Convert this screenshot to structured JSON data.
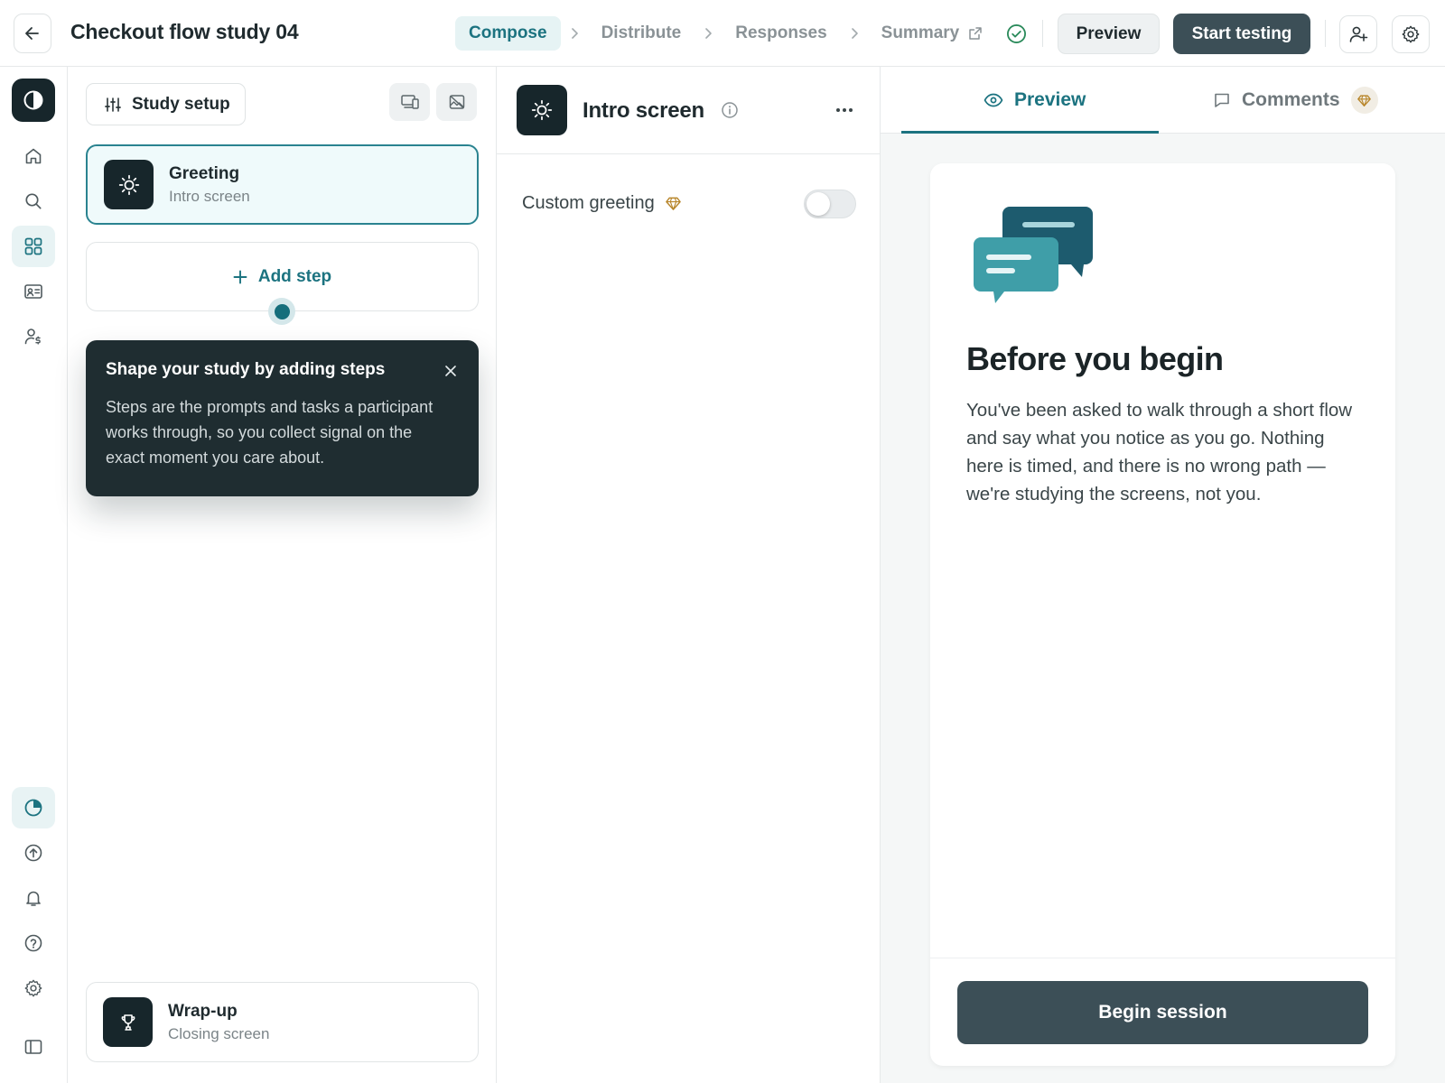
{
  "header": {
    "title": "Checkout flow study 04",
    "steps": [
      {
        "label": "Compose"
      },
      {
        "label": "Distribute"
      },
      {
        "label": "Responses"
      },
      {
        "label": "Summary"
      }
    ],
    "preview_label": "Preview",
    "start_label": "Start testing"
  },
  "steps_panel": {
    "setup_label": "Study setup",
    "steps": [
      {
        "name": "Greeting",
        "sub": "Intro screen"
      },
      {
        "name": "Wrap-up",
        "sub": "Closing screen"
      }
    ],
    "add_step_label": "Add step",
    "tooltip": {
      "title": "Shape your study by adding steps",
      "body": "Steps are the prompts and tasks a participant works through, so you collect signal on the exact moment you care about."
    }
  },
  "config": {
    "title": "Intro screen",
    "field_label": "Custom greeting",
    "toggle_on": false
  },
  "preview": {
    "tabs": [
      {
        "label": "Preview"
      },
      {
        "label": "Comments"
      }
    ],
    "heading": "Before you begin",
    "body": "You've been asked to walk through a short flow and say what you notice as you go. Nothing here is timed, and there is no wrong path — we're studying the screens, not you.",
    "button_label": "Begin session"
  },
  "icons": {
    "rail": [
      "contrast-icon",
      "home-icon",
      "search-icon",
      "grid-icon",
      "id-card-icon",
      "user-billing-icon",
      "pie-chart-icon",
      "upload-circle-icon",
      "bell-icon",
      "help-icon",
      "gear-icon",
      "sidebar-toggle-icon"
    ]
  },
  "colors": {
    "accent": "#1c7380",
    "dark": "#17262b",
    "button_dark": "#3c4f57",
    "active_tab_bg": "#e6f3f4",
    "success": "#2a8a5a",
    "premium": "#b8862b"
  }
}
